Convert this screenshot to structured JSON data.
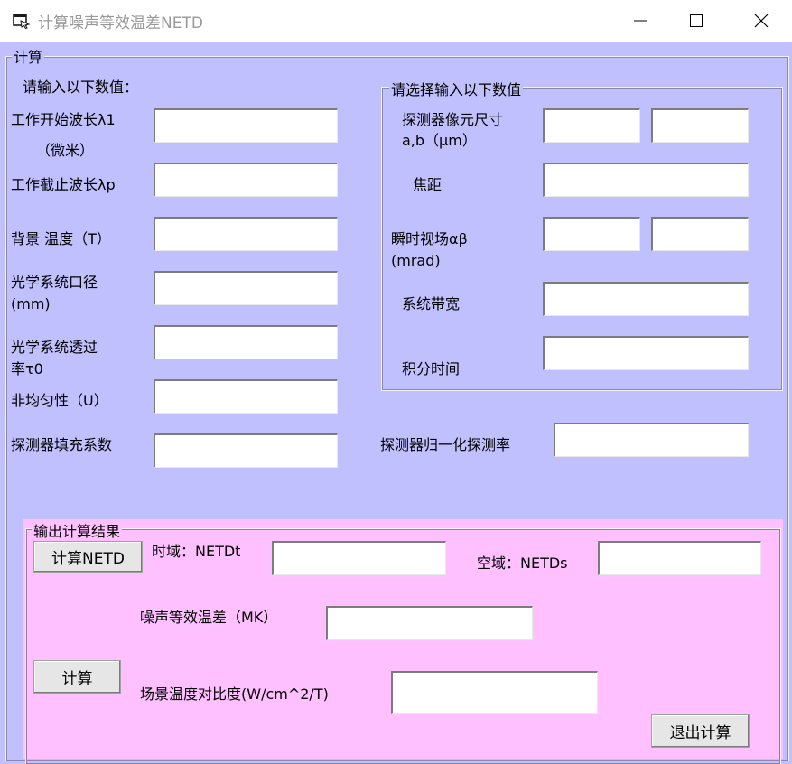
{
  "window": {
    "title": "计算噪声等效温差NETD",
    "icon": "app-window-icon",
    "controls": [
      "minimize-icon",
      "maximize-icon",
      "close-icon"
    ]
  },
  "main_group": {
    "title": "计算"
  },
  "left_inputs": {
    "heading": "请输入以下数值：",
    "start_wavelength": {
      "label": "工作开始波长λ1",
      "unit": "（微米）",
      "value": ""
    },
    "cutoff_wavelength": {
      "label": "工作截止波长λp",
      "value": ""
    },
    "background_temp": {
      "label": "背景 温度（T）",
      "value": ""
    },
    "aperture": {
      "label_line1": "光学系统口径",
      "label_line2": "(mm)",
      "value": ""
    },
    "transmittance": {
      "label_line1": "光学系统透过",
      "label_line2": "率τ0",
      "value": ""
    },
    "nonuniformity": {
      "label": "非均匀性（U）",
      "value": ""
    },
    "fill_factor": {
      "label": "探测器填充系数",
      "value": ""
    }
  },
  "right_group": {
    "title": "请选择输入以下数值",
    "pixel_size": {
      "label_line1": "探测器像元尺寸",
      "label_line2": "a,b（μm）",
      "value_a": "",
      "value_b": ""
    },
    "focal_length": {
      "label": "焦距",
      "value": ""
    },
    "ifov": {
      "label_line1": "瞬时视场αβ",
      "label_line2": "(mrad)",
      "value_a": "",
      "value_b": ""
    },
    "bandwidth": {
      "label": "系统带宽",
      "value": ""
    },
    "integration_time": {
      "label": "积分时间",
      "value": ""
    }
  },
  "detectivity": {
    "label": "探测器归一化探测率",
    "value": ""
  },
  "output_group": {
    "title": "输出计算结果",
    "calc_netd_button": "计算NETD",
    "time_domain": {
      "label": "时域：NETDt",
      "value": ""
    },
    "space_domain": {
      "label": "空域：NETDs",
      "value": ""
    },
    "netd_mk": {
      "label": "噪声等效温差（MK）",
      "value": ""
    },
    "calc_button": "计算",
    "contrast": {
      "label": "场景温度对比度(W/cm^2/T)",
      "value": ""
    },
    "exit_button": "退出计算"
  }
}
